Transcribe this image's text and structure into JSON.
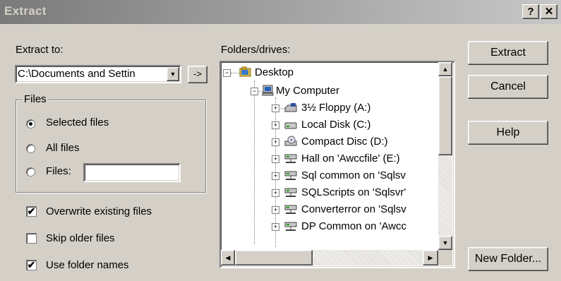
{
  "window": {
    "title": "Extract",
    "help_glyph": "?",
    "close_glyph": "✕"
  },
  "extract_to": {
    "label": "Extract to:",
    "path_value": "C:\\Documents and Settin",
    "arrow_glyph": "->"
  },
  "files_group": {
    "label": "Files",
    "options": [
      {
        "label": "Selected files",
        "selected": true
      },
      {
        "label": "All files",
        "selected": false
      },
      {
        "label": "Files:",
        "selected": false
      }
    ],
    "files_value": ""
  },
  "checkboxes": [
    {
      "label": "Overwrite existing files",
      "checked": true
    },
    {
      "label": "Skip older files",
      "checked": false
    },
    {
      "label": "Use folder names",
      "checked": true
    }
  ],
  "folders": {
    "label": "Folders/drives:",
    "items": [
      {
        "label": "Desktop",
        "icon": "desktop-folder-icon"
      },
      {
        "label": "My Computer",
        "icon": "computer-icon"
      },
      {
        "label": "3½ Floppy (A:)",
        "icon": "floppy-drive-icon"
      },
      {
        "label": "Local Disk (C:)",
        "icon": "hard-disk-icon"
      },
      {
        "label": "Compact Disc (D:)",
        "icon": "cd-drive-icon"
      },
      {
        "label": "Hall on 'Awccfile' (E:)",
        "icon": "network-drive-icon"
      },
      {
        "label": "Sql common on 'Sqlsv",
        "icon": "network-drive-icon"
      },
      {
        "label": "SQLScripts on 'Sqlsvr'",
        "icon": "network-drive-icon"
      },
      {
        "label": "Converterror on 'Sqlsv",
        "icon": "network-drive-icon"
      },
      {
        "label": "DP Common on 'Awcc",
        "icon": "network-drive-icon"
      }
    ],
    "expand_glyph": "+",
    "collapse_glyph": "−"
  },
  "buttons": {
    "extract": "Extract",
    "cancel": "Cancel",
    "help": "Help",
    "new_folder": "New Folder..."
  },
  "colors": {
    "face": "#d4d0c8",
    "shadow": "#808080",
    "title_text": "#d4d0c8"
  }
}
